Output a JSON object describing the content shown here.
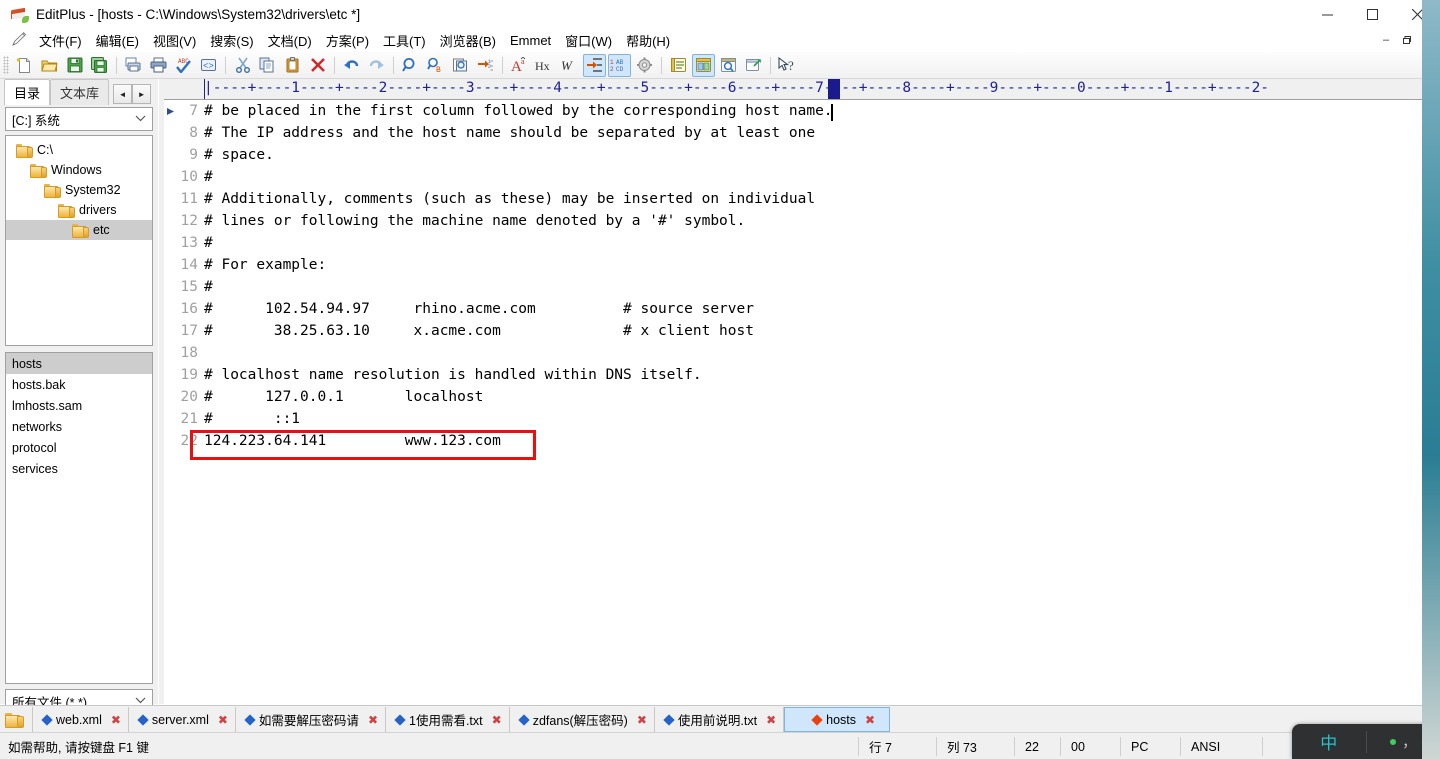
{
  "window": {
    "title": "EditPlus - [hosts - C:\\Windows\\System32\\drivers\\etc *]",
    "app_icon": "editplus-book-icon",
    "minimize_label": "—",
    "maximize_label": "□",
    "close_label": "✕",
    "mdi_minimize": "–",
    "mdi_restore": "❐",
    "mdi_close": "✕"
  },
  "menubar": {
    "pencil_icon": "pencil-icon",
    "items": [
      {
        "label": "文件(F)",
        "name": "menu-file"
      },
      {
        "label": "编辑(E)",
        "name": "menu-edit"
      },
      {
        "label": "视图(V)",
        "name": "menu-view"
      },
      {
        "label": "搜索(S)",
        "name": "menu-search"
      },
      {
        "label": "文档(D)",
        "name": "menu-document"
      },
      {
        "label": "方案(P)",
        "name": "menu-project"
      },
      {
        "label": "工具(T)",
        "name": "menu-tools"
      },
      {
        "label": "浏览器(B)",
        "name": "menu-browser"
      },
      {
        "label": "Emmet",
        "name": "menu-emmet"
      },
      {
        "label": "窗口(W)",
        "name": "menu-window"
      },
      {
        "label": "帮助(H)",
        "name": "menu-help"
      }
    ]
  },
  "toolbar": {
    "buttons": [
      {
        "icon": "new-file-icon",
        "active": false
      },
      {
        "icon": "open-folder-icon",
        "active": false
      },
      {
        "icon": "save-icon",
        "active": false
      },
      {
        "icon": "save-all-icon",
        "active": false
      },
      {
        "sep": true
      },
      {
        "icon": "print-preview-icon",
        "active": false
      },
      {
        "icon": "print-icon",
        "active": false
      },
      {
        "icon": "spellcheck-icon",
        "active": false
      },
      {
        "icon": "view-source-icon",
        "active": false
      },
      {
        "sep": true
      },
      {
        "icon": "cut-icon",
        "active": false
      },
      {
        "icon": "copy-icon",
        "active": false
      },
      {
        "icon": "paste-icon",
        "active": false
      },
      {
        "icon": "delete-icon",
        "active": false
      },
      {
        "sep": true
      },
      {
        "icon": "undo-icon",
        "active": false
      },
      {
        "icon": "redo-icon",
        "active": false
      },
      {
        "sep": true
      },
      {
        "icon": "find-icon",
        "active": false
      },
      {
        "icon": "replace-icon",
        "active": false
      },
      {
        "icon": "find-in-files-icon",
        "active": false
      },
      {
        "icon": "goto-line-icon",
        "active": false
      },
      {
        "sep": true
      },
      {
        "icon": "font-icon",
        "active": false
      },
      {
        "icon": "hex-icon",
        "active": false
      },
      {
        "icon": "word-wrap-icon",
        "active": false
      },
      {
        "icon": "indent-icon",
        "active": true
      },
      {
        "icon": "sort-icon",
        "active": true
      },
      {
        "icon": "settings-gear-icon",
        "active": false
      },
      {
        "sep": true
      },
      {
        "icon": "document-list-icon",
        "active": false
      },
      {
        "icon": "split-window-icon",
        "active": true
      },
      {
        "icon": "preview-browser-icon",
        "active": false
      },
      {
        "icon": "external-browser-icon",
        "active": false
      },
      {
        "sep": true
      },
      {
        "icon": "help-pointer-icon",
        "active": false
      }
    ]
  },
  "sidebar": {
    "tabs": [
      {
        "label": "目录",
        "active": true,
        "name": "sidebar-tab-directory"
      },
      {
        "label": "文本库",
        "active": false,
        "name": "sidebar-tab-cliptext"
      }
    ],
    "nav_prev": "◄",
    "nav_next": "►",
    "drive_label": "[C:] 系统",
    "tree": [
      {
        "label": "C:\\",
        "depth": 0,
        "selected": false
      },
      {
        "label": "Windows",
        "depth": 1,
        "selected": false
      },
      {
        "label": "System32",
        "depth": 2,
        "selected": false
      },
      {
        "label": "drivers",
        "depth": 3,
        "selected": false
      },
      {
        "label": "etc",
        "depth": 4,
        "selected": true
      }
    ],
    "files": [
      {
        "label": "hosts",
        "selected": true
      },
      {
        "label": "hosts.bak",
        "selected": false
      },
      {
        "label": "lmhosts.sam",
        "selected": false
      },
      {
        "label": "networks",
        "selected": false
      },
      {
        "label": "protocol",
        "selected": false
      },
      {
        "label": "services",
        "selected": false
      }
    ],
    "filter_label": "所有文件 (*.*)"
  },
  "editor": {
    "ruler_text": "|----+----1----+----2----+----3----+----4----+----5----+----6----+----7----+----8----+----9----+----0----+----1----+----2-",
    "ruler_caret_col": 73,
    "first_line_number": 7,
    "bookmark_line": 7,
    "caret_line": 7,
    "caret_col": 73,
    "lines": [
      {
        "num": 7,
        "text": "# be placed in the first column followed by the corresponding host name."
      },
      {
        "num": 8,
        "text": "# The IP address and the host name should be separated by at least one"
      },
      {
        "num": 9,
        "text": "# space."
      },
      {
        "num": 10,
        "text": "#"
      },
      {
        "num": 11,
        "text": "# Additionally, comments (such as these) may be inserted on individual"
      },
      {
        "num": 12,
        "text": "# lines or following the machine name denoted by a '#' symbol."
      },
      {
        "num": 13,
        "text": "#"
      },
      {
        "num": 14,
        "text": "# For example:"
      },
      {
        "num": 15,
        "text": "#"
      },
      {
        "num": 16,
        "text": "#      102.54.94.97     rhino.acme.com          # source server"
      },
      {
        "num": 17,
        "text": "#       38.25.63.10     x.acme.com              # x client host"
      },
      {
        "num": 18,
        "text": ""
      },
      {
        "num": 19,
        "text": "# localhost name resolution is handled within DNS itself."
      },
      {
        "num": 20,
        "text": "#      127.0.0.1       localhost"
      },
      {
        "num": 21,
        "text": "#       ::1"
      },
      {
        "num": 22,
        "text": "124.223.64.141         www.123.com"
      }
    ],
    "highlight": {
      "line": 22,
      "color": "#e8110f"
    },
    "scroll_up_arrow": "▲",
    "scroll_down_arrow": "▼",
    "scroll_left_arrow": "◀",
    "scroll_right_arrow": "▶"
  },
  "doc_tabs": {
    "folder_icon": "folder-icon",
    "items": [
      {
        "label": "web.xml",
        "active": false,
        "close": "✖"
      },
      {
        "label": "server.xml",
        "active": false,
        "close": "✖"
      },
      {
        "label": "如需要解压密码请",
        "active": false,
        "close": "✖"
      },
      {
        "label": "1使用需看.txt",
        "active": false,
        "close": "✖"
      },
      {
        "label": "zdfans(解压密码)",
        "active": false,
        "close": "✖"
      },
      {
        "label": "使用前说明.txt",
        "active": false,
        "close": "✖"
      },
      {
        "label": "hosts",
        "active": true,
        "close": "✖"
      }
    ]
  },
  "statusbar": {
    "message": "如需帮助, 请按键盘 F1 键",
    "line": "行 7",
    "col": "列 73",
    "char_count": "22",
    "hex": "00",
    "line_ending": "PC",
    "encoding": "ANSI"
  },
  "ime": {
    "mode_label": "中",
    "punct_label": "，",
    "dot_color": "#3ecf5e"
  },
  "colors": {
    "accent": "#2563c7",
    "highlight_red": "#e8110f",
    "ruler_blue": "#1f1f9a",
    "selection_gray": "#cdcdcd",
    "active_tab_blue": "#cfe6fb"
  }
}
